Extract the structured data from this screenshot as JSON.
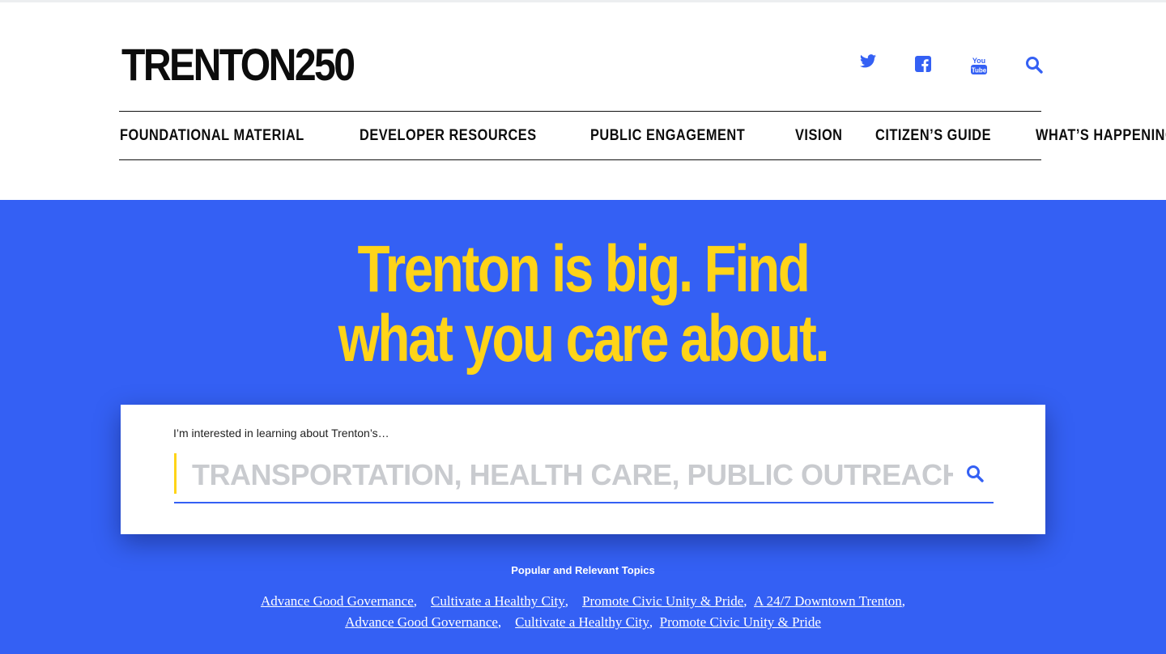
{
  "site": {
    "logo": "TRENTON250"
  },
  "header": {
    "social": [
      {
        "name": "twitter-icon"
      },
      {
        "name": "facebook-icon"
      },
      {
        "name": "youtube-icon"
      },
      {
        "name": "search-icon"
      }
    ]
  },
  "nav": {
    "items": [
      {
        "label": "FOUNDATIONAL MATERIAL"
      },
      {
        "label": "DEVELOPER RESOURCES"
      },
      {
        "label": "PUBLIC ENGAGEMENT"
      },
      {
        "label": "VISION"
      },
      {
        "label": "CITIZEN’S GUIDE"
      },
      {
        "label": "WHAT’S HAPPENING"
      }
    ]
  },
  "hero": {
    "headline_line1": "Trenton is big. Find",
    "headline_line2": "what you care about."
  },
  "search": {
    "label": "I’m interested in learning about Trenton’s…",
    "placeholder": "TRANSPORTATION, HEALTH CARE, PUBLIC OUTREACH",
    "value": ""
  },
  "topics": {
    "title": "Popular and Relevant Topics",
    "row1": [
      "Advance Good Governance",
      "Cultivate a Healthy City",
      "Promote Civic Unity & Pride",
      "A 24/7 Downtown Trenton"
    ],
    "row2": [
      "Advance Good Governance",
      "Cultivate a Healthy City",
      "Promote Civic Unity & Pride"
    ]
  },
  "colors": {
    "brand_blue": "#3460f4",
    "accent_yellow": "#ffd418",
    "text_dark": "#0c0c0c"
  }
}
